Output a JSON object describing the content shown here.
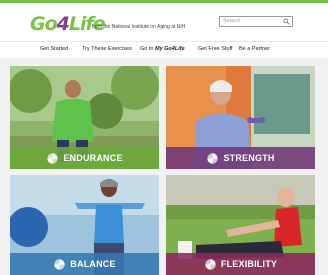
{
  "header": {
    "logo": {
      "prefix": "Go",
      "number": "4",
      "suffix": "Life"
    },
    "tagline": "from the National Institute on Aging at NIH",
    "search": {
      "placeholder": "Search"
    }
  },
  "nav": {
    "items": [
      {
        "label": "Get Started"
      },
      {
        "label": "Try These Exercises"
      },
      {
        "label_prefix": "Go to",
        "label_emph": "My Go4Life"
      },
      {
        "label": "Get Free Stuff"
      },
      {
        "label": "Be a Partner"
      }
    ]
  },
  "cards": [
    {
      "label": "ENDURANCE",
      "icon": "go4life-pinwheel-icon",
      "color": "#6baa3c"
    },
    {
      "label": "STRENGTH",
      "icon": "go4life-pinwheel-icon",
      "color": "#6e3778"
    },
    {
      "label": "BALANCE",
      "icon": "go4life-pinwheel-icon",
      "color": "#3778b4"
    },
    {
      "label": "FLEXIBILITY",
      "icon": "go4life-pinwheel-icon",
      "color": "#8c285a"
    }
  ],
  "colors": {
    "brand_green": "#7cc242",
    "brand_purple": "#8b3a8f"
  }
}
